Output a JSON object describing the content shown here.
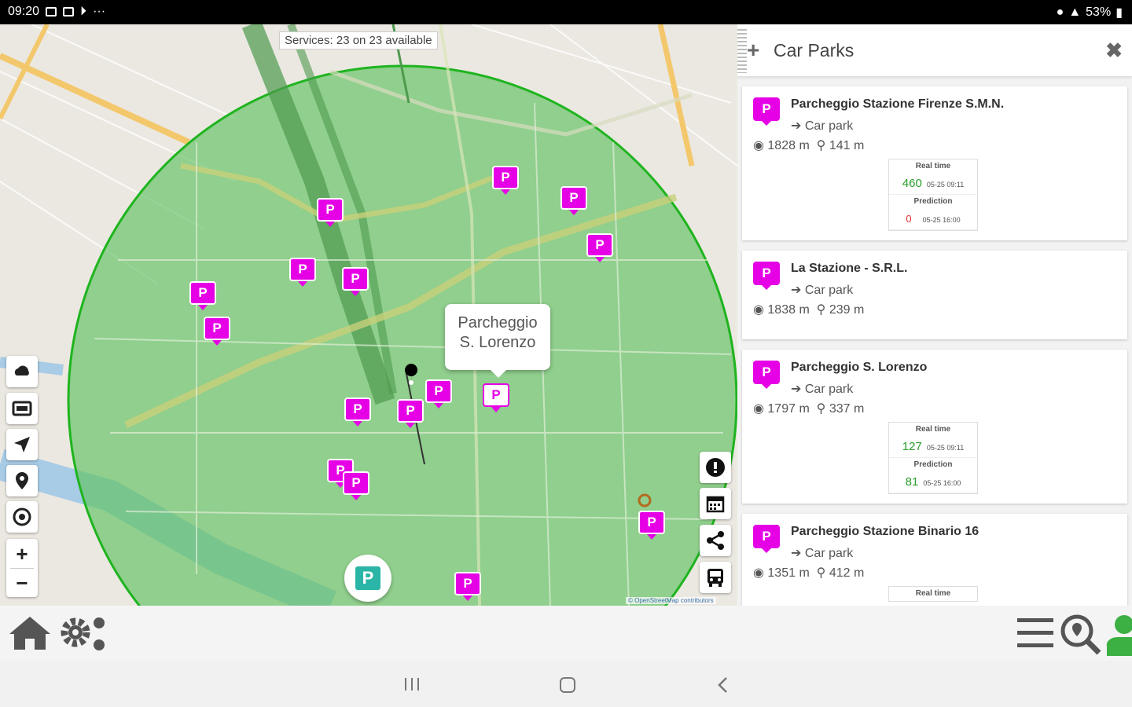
{
  "status_bar": {
    "time": "09:20",
    "dots": "···",
    "battery": "53%"
  },
  "map": {
    "services_label": "Services: 23 on 23 available",
    "popup_line1": "Parcheggio",
    "popup_line2": "S. Lorenzo",
    "marker_label": "P",
    "parking_button_label": "P",
    "attribution": "© OpenStreetMap contributors",
    "zoom_in": "+",
    "zoom_out": "−"
  },
  "panel": {
    "title": "Car Parks",
    "add_symbol": "+",
    "close_symbol": "✖",
    "items": [
      {
        "name": "Parcheggio Stazione Firenze S.M.N.",
        "type": "Car park",
        "distance1": "1828 m",
        "distance2": "141 m",
        "realtime_label": "Real time",
        "realtime_value": "460",
        "realtime_time": "05-25 09:11",
        "prediction_label": "Prediction",
        "prediction_value": "0",
        "prediction_time": "05-25 16:00"
      },
      {
        "name": "La Stazione - S.R.L.",
        "type": "Car park",
        "distance1": "1838 m",
        "distance2": "239 m"
      },
      {
        "name": "Parcheggio S. Lorenzo",
        "type": "Car park",
        "distance1": "1797 m",
        "distance2": "337 m",
        "realtime_label": "Real time",
        "realtime_value": "127",
        "realtime_time": "05-25 09:11",
        "prediction_label": "Prediction",
        "prediction_value": "81",
        "prediction_time": "05-25 16:00"
      },
      {
        "name": "Parcheggio Stazione Binario 16",
        "type": "Car park",
        "distance1": "1351 m",
        "distance2": "412 m",
        "realtime_label": "Real time"
      }
    ]
  },
  "colors": {
    "marker": "#e600e6",
    "coverage": "#22b322",
    "teal": "#2bb5a6",
    "realtime": "#2a9d2a",
    "prediction": "#e03030"
  }
}
